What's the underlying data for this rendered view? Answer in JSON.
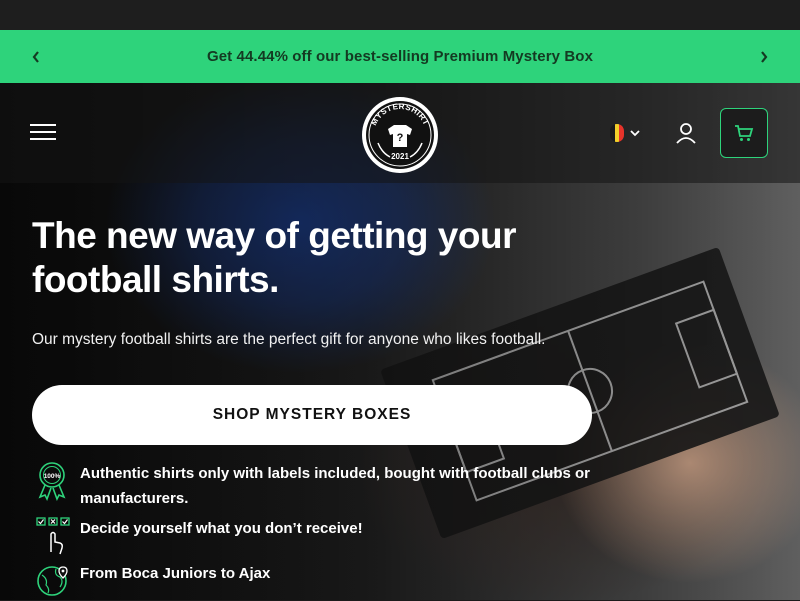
{
  "announcement": {
    "message": "Get 44.44% off our best-selling Premium Mystery Box"
  },
  "header": {
    "logo_text_top": "MYSTERSHIRT",
    "logo_year": "2021"
  },
  "hero": {
    "title": "The new way of getting your football shirts.",
    "subtitle": "Our mystery football shirts are the perfect gift for anyone who likes football.",
    "cta_label": "SHOP MYSTERY BOXES"
  },
  "features": [
    {
      "icon": "award-badge-icon",
      "text": "Authentic shirts only with labels included, bought with football clubs or manufacturers."
    },
    {
      "icon": "checklist-hand-icon",
      "text": "Decide yourself what you don’t receive!"
    },
    {
      "icon": "globe-pin-icon",
      "text": "From Boca Juniors to Ajax"
    }
  ],
  "colors": {
    "accent": "#2ed37b",
    "announcement_text": "#143a22",
    "background": "#1b1b1b"
  },
  "icons": {
    "prev": "chevron-left-icon",
    "next": "chevron-right-icon",
    "menu": "hamburger-menu-icon",
    "country": "belgium-flag-icon",
    "account": "user-icon",
    "cart": "cart-icon"
  }
}
